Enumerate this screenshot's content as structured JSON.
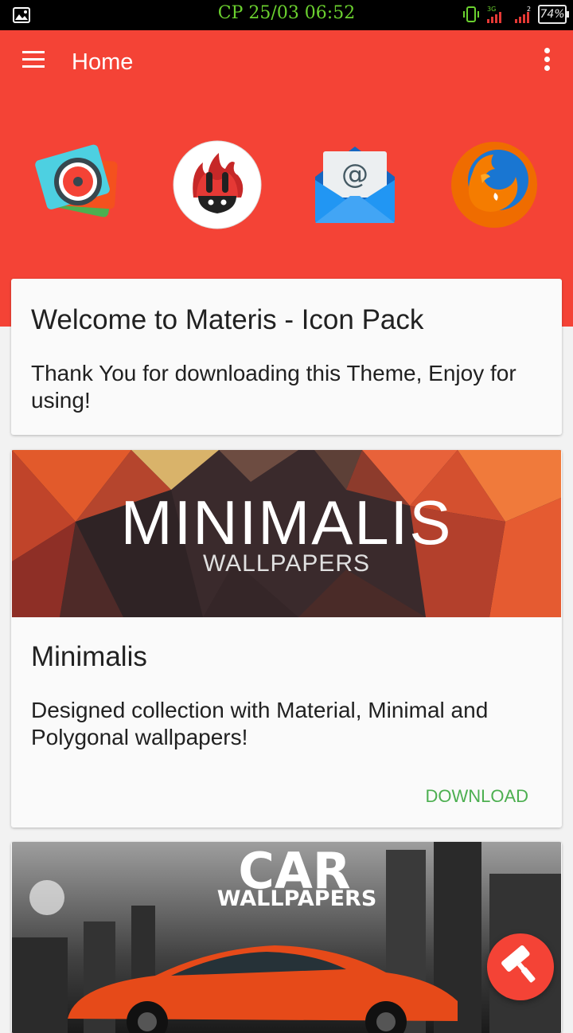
{
  "status_bar": {
    "time": "CP 25/03 06:52",
    "network": "3G",
    "battery": "74%"
  },
  "header": {
    "title": "Home",
    "app_icons": [
      "camera-app-icon",
      "antutu-app-icon",
      "email-app-icon",
      "firefox-app-icon"
    ]
  },
  "welcome_card": {
    "title": "Welcome to Materis - Icon Pack",
    "text": "Thank You for downloading this Theme, Enjoy for using!"
  },
  "minimalis_card": {
    "banner_title": "MINIMALIS",
    "banner_subtitle": "WALLPAPERS",
    "title": "Minimalis",
    "text": "Designed collection with Material, Minimal and Polygonal wallpapers!",
    "action_label": "DOWNLOAD"
  },
  "car_card": {
    "banner_title": "CAR",
    "banner_subtitle": "WALLPAPERS"
  },
  "colors": {
    "primary": "#f44336",
    "accent_action": "#4caf50",
    "status_clock": "#6bd12f"
  }
}
